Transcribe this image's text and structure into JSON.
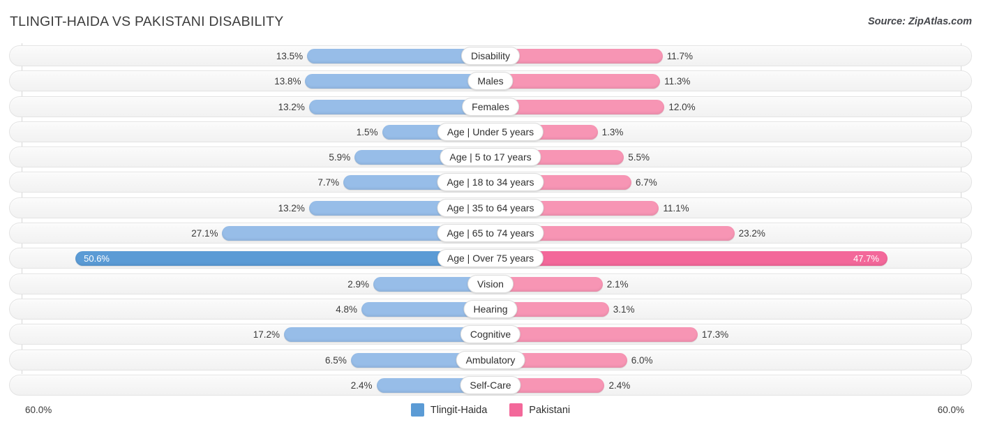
{
  "header": {
    "title": "TLINGIT-HAIDA VS PAKISTANI DISABILITY",
    "source": "Source: ZipAtlas.com"
  },
  "axis": {
    "left_max_label": "60.0%",
    "right_max_label": "60.0%"
  },
  "legend": {
    "items": [
      {
        "label": "Tlingit-Haida",
        "color": "#5b9bd5"
      },
      {
        "label": "Pakistani",
        "color": "#f3689a"
      }
    ]
  },
  "colors": {
    "left_bar": "#97bde8",
    "right_bar": "#f795b4",
    "left_bar_highlight": "#5b9bd5",
    "right_bar_highlight": "#f3689a",
    "row_track": "#f6f6f6",
    "gridline": "#d6d6d6",
    "title_text": "#3c3c3c"
  },
  "chart_data": {
    "type": "bar",
    "title": "TLINGIT-HAIDA VS PAKISTANI DISABILITY",
    "subtitle": "",
    "orientation": "horizontal-diverging",
    "xlabel": "",
    "ylabel": "",
    "xlim": [
      60.0,
      60.0
    ],
    "grid": true,
    "legend_position": "bottom-center",
    "categories": [
      "Disability",
      "Males",
      "Females",
      "Age | Under 5 years",
      "Age | 5 to 17 years",
      "Age | 18 to 34 years",
      "Age | 35 to 64 years",
      "Age | 65 to 74 years",
      "Age | Over 75 years",
      "Vision",
      "Hearing",
      "Cognitive",
      "Ambulatory",
      "Self-Care"
    ],
    "series": [
      {
        "name": "Tlingit-Haida",
        "side": "left",
        "color": "#97bde8",
        "values": [
          13.5,
          13.8,
          13.2,
          1.5,
          5.9,
          7.7,
          13.2,
          27.1,
          50.6,
          2.9,
          4.8,
          17.2,
          6.5,
          2.4
        ],
        "labels": [
          "13.5%",
          "13.8%",
          "13.2%",
          "1.5%",
          "5.9%",
          "7.7%",
          "13.2%",
          "27.1%",
          "50.6%",
          "2.9%",
          "4.8%",
          "17.2%",
          "6.5%",
          "2.4%"
        ]
      },
      {
        "name": "Pakistani",
        "side": "right",
        "color": "#f795b4",
        "values": [
          11.7,
          11.3,
          12.0,
          1.3,
          5.5,
          6.7,
          11.1,
          23.2,
          47.7,
          2.1,
          3.1,
          17.3,
          6.0,
          2.4
        ],
        "labels": [
          "11.7%",
          "11.3%",
          "12.0%",
          "1.3%",
          "5.5%",
          "6.7%",
          "11.1%",
          "23.2%",
          "47.7%",
          "2.1%",
          "3.1%",
          "17.3%",
          "6.0%",
          "2.4%"
        ]
      }
    ],
    "highlight_row_index": 8
  }
}
